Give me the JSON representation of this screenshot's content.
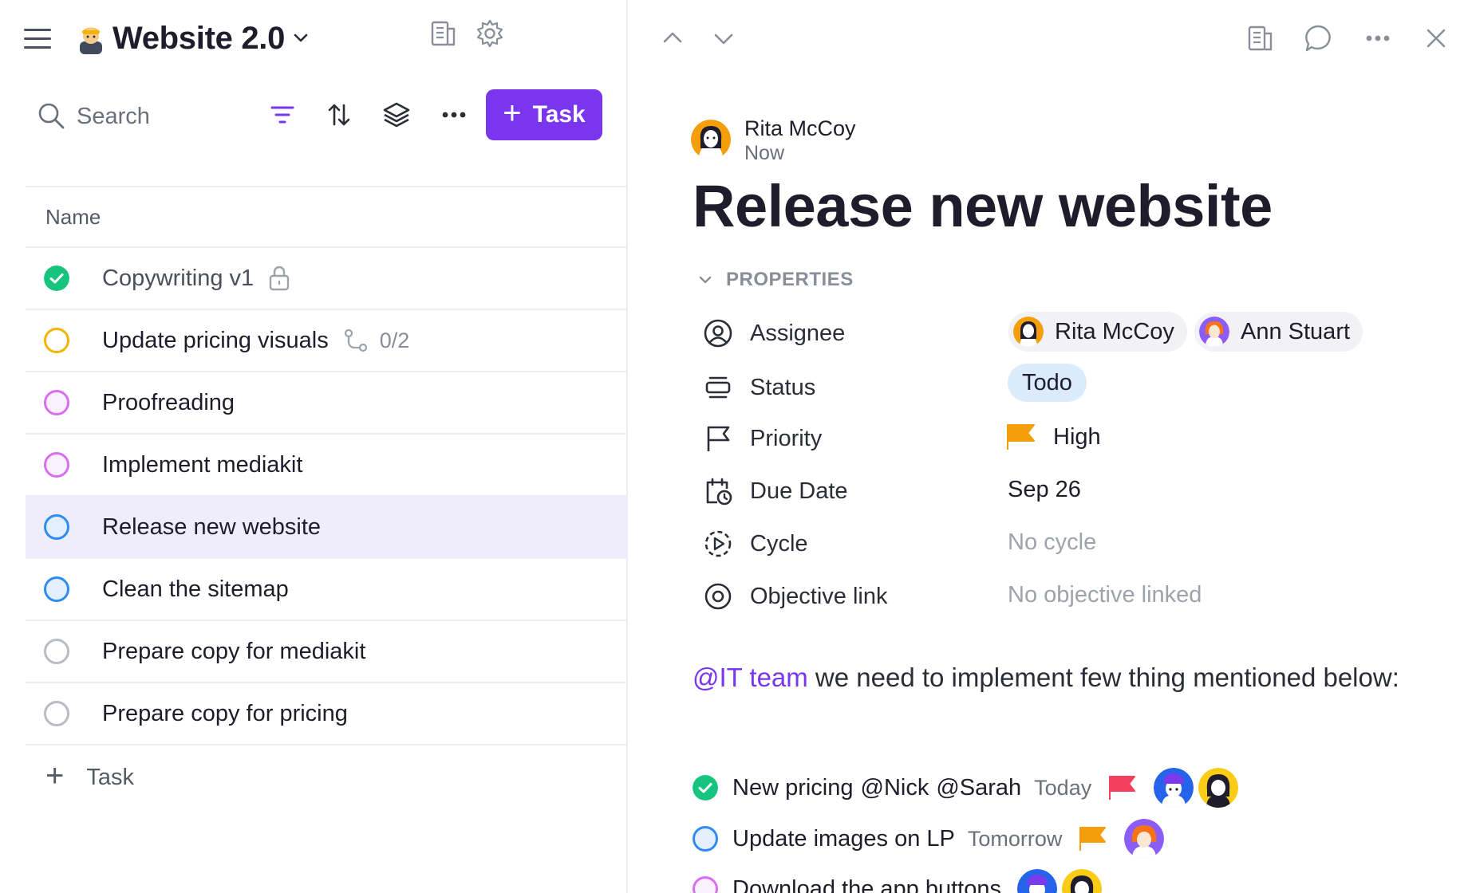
{
  "project": {
    "title": "Website 2.0",
    "emoji": "person-in-cap-emoji"
  },
  "toolbar": {
    "search_placeholder": "Search",
    "add_task_label": "Task"
  },
  "table": {
    "column_header": "Name",
    "rows": [
      {
        "label": "Copywriting v1",
        "status": "done",
        "status_color": "#16c47f",
        "extra": "lock-icon"
      },
      {
        "label": "Update pricing visuals",
        "status": "in-progress",
        "status_color": "#f5b400",
        "extra": "subtasks-icon",
        "subtasks": "0/2"
      },
      {
        "label": "Proofreading",
        "status": "review",
        "status_color": "#d86ff0"
      },
      {
        "label": "Implement mediakit",
        "status": "review",
        "status_color": "#d86ff0"
      },
      {
        "label": "Release new website",
        "status": "todo",
        "status_color": "#2f8cf0",
        "selected": true
      },
      {
        "label": "Clean the sitemap",
        "status": "todo",
        "status_color": "#2f8cf0"
      },
      {
        "label": "Prepare copy for mediakit",
        "status": "backlog",
        "status_color": "#b9bcc4"
      },
      {
        "label": "Prepare copy for pricing",
        "status": "backlog",
        "status_color": "#b9bcc4"
      }
    ],
    "add_task_label": "Task"
  },
  "detail": {
    "author": {
      "name": "Rita McCoy",
      "time": "Now"
    },
    "title": "Release new website",
    "properties_header": "PROPERTIES",
    "properties": {
      "assignee": {
        "label": "Assignee",
        "people": [
          "Rita McCoy",
          "Ann Stuart"
        ]
      },
      "status": {
        "label": "Status",
        "value": "Todo"
      },
      "priority": {
        "label": "Priority",
        "value": "High",
        "color": "#f59e0b"
      },
      "due_date": {
        "label": "Due Date",
        "value": "Sep 26"
      },
      "cycle": {
        "label": "Cycle",
        "value": "No cycle"
      },
      "objective": {
        "label": "Objective link",
        "value": "No objective linked"
      }
    },
    "description": {
      "mention": "@IT team",
      "text": " we need to implement few thing mentioned below:"
    },
    "checklist": [
      {
        "text": "New pricing",
        "mentions": [
          "@Nick",
          "@Sarah"
        ],
        "date": "Today",
        "flag_color": "#f43f5e",
        "done": true
      },
      {
        "text": "Update images on LP",
        "mentions": [],
        "date": "Tomorrow",
        "flag_color": "#f59e0b",
        "done": false
      },
      {
        "text": "Download the app buttons",
        "mentions": [],
        "date": "",
        "done": false
      }
    ]
  },
  "colors": {
    "accent": "#7a35ef",
    "selected_row": "#efedfc",
    "status_chip": "#dbeafd"
  }
}
